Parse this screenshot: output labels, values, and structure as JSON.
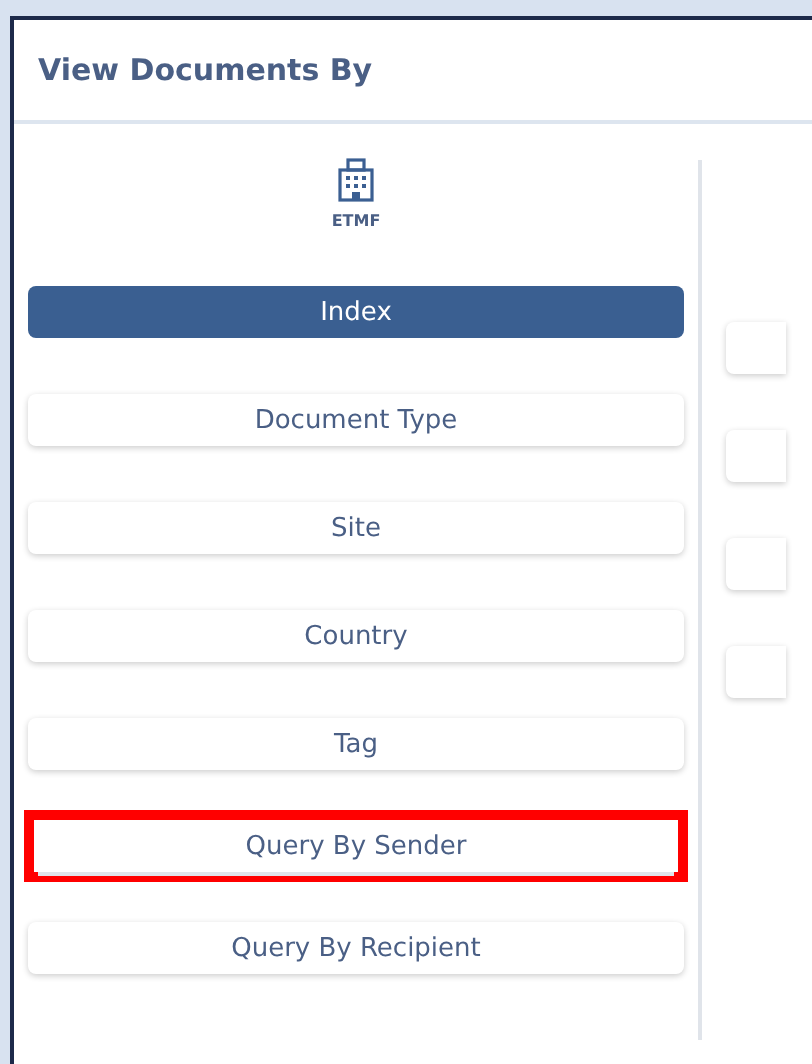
{
  "panel": {
    "title": "View Documents By"
  },
  "left_column": {
    "heading": "ETMF",
    "items": [
      {
        "label": "Index",
        "selected": true,
        "highlighted": false
      },
      {
        "label": "Document Type",
        "selected": false,
        "highlighted": false
      },
      {
        "label": "Site",
        "selected": false,
        "highlighted": false
      },
      {
        "label": "Country",
        "selected": false,
        "highlighted": false
      },
      {
        "label": "Tag",
        "selected": false,
        "highlighted": false
      },
      {
        "label": "Query By Sender",
        "selected": false,
        "highlighted": true
      },
      {
        "label": "Query By Recipient",
        "selected": false,
        "highlighted": false
      }
    ]
  },
  "right_column": {
    "items": [
      {
        "selected": false
      },
      {
        "selected": false
      },
      {
        "selected": false
      },
      {
        "selected": false
      }
    ]
  }
}
